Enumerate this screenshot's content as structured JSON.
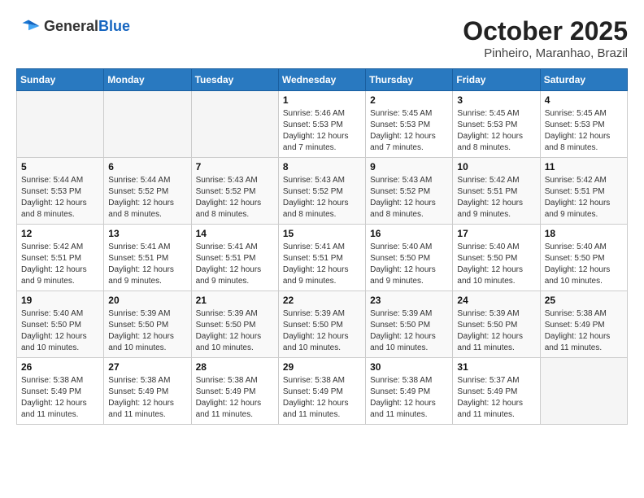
{
  "header": {
    "logo_general": "General",
    "logo_blue": "Blue",
    "month": "October 2025",
    "location": "Pinheiro, Maranhao, Brazil"
  },
  "days_of_week": [
    "Sunday",
    "Monday",
    "Tuesday",
    "Wednesday",
    "Thursday",
    "Friday",
    "Saturday"
  ],
  "weeks": [
    [
      {
        "day": "",
        "info": ""
      },
      {
        "day": "",
        "info": ""
      },
      {
        "day": "",
        "info": ""
      },
      {
        "day": "1",
        "info": "Sunrise: 5:46 AM\nSunset: 5:53 PM\nDaylight: 12 hours\nand 7 minutes."
      },
      {
        "day": "2",
        "info": "Sunrise: 5:45 AM\nSunset: 5:53 PM\nDaylight: 12 hours\nand 7 minutes."
      },
      {
        "day": "3",
        "info": "Sunrise: 5:45 AM\nSunset: 5:53 PM\nDaylight: 12 hours\nand 8 minutes."
      },
      {
        "day": "4",
        "info": "Sunrise: 5:45 AM\nSunset: 5:53 PM\nDaylight: 12 hours\nand 8 minutes."
      }
    ],
    [
      {
        "day": "5",
        "info": "Sunrise: 5:44 AM\nSunset: 5:53 PM\nDaylight: 12 hours\nand 8 minutes."
      },
      {
        "day": "6",
        "info": "Sunrise: 5:44 AM\nSunset: 5:52 PM\nDaylight: 12 hours\nand 8 minutes."
      },
      {
        "day": "7",
        "info": "Sunrise: 5:43 AM\nSunset: 5:52 PM\nDaylight: 12 hours\nand 8 minutes."
      },
      {
        "day": "8",
        "info": "Sunrise: 5:43 AM\nSunset: 5:52 PM\nDaylight: 12 hours\nand 8 minutes."
      },
      {
        "day": "9",
        "info": "Sunrise: 5:43 AM\nSunset: 5:52 PM\nDaylight: 12 hours\nand 8 minutes."
      },
      {
        "day": "10",
        "info": "Sunrise: 5:42 AM\nSunset: 5:51 PM\nDaylight: 12 hours\nand 9 minutes."
      },
      {
        "day": "11",
        "info": "Sunrise: 5:42 AM\nSunset: 5:51 PM\nDaylight: 12 hours\nand 9 minutes."
      }
    ],
    [
      {
        "day": "12",
        "info": "Sunrise: 5:42 AM\nSunset: 5:51 PM\nDaylight: 12 hours\nand 9 minutes."
      },
      {
        "day": "13",
        "info": "Sunrise: 5:41 AM\nSunset: 5:51 PM\nDaylight: 12 hours\nand 9 minutes."
      },
      {
        "day": "14",
        "info": "Sunrise: 5:41 AM\nSunset: 5:51 PM\nDaylight: 12 hours\nand 9 minutes."
      },
      {
        "day": "15",
        "info": "Sunrise: 5:41 AM\nSunset: 5:51 PM\nDaylight: 12 hours\nand 9 minutes."
      },
      {
        "day": "16",
        "info": "Sunrise: 5:40 AM\nSunset: 5:50 PM\nDaylight: 12 hours\nand 9 minutes."
      },
      {
        "day": "17",
        "info": "Sunrise: 5:40 AM\nSunset: 5:50 PM\nDaylight: 12 hours\nand 10 minutes."
      },
      {
        "day": "18",
        "info": "Sunrise: 5:40 AM\nSunset: 5:50 PM\nDaylight: 12 hours\nand 10 minutes."
      }
    ],
    [
      {
        "day": "19",
        "info": "Sunrise: 5:40 AM\nSunset: 5:50 PM\nDaylight: 12 hours\nand 10 minutes."
      },
      {
        "day": "20",
        "info": "Sunrise: 5:39 AM\nSunset: 5:50 PM\nDaylight: 12 hours\nand 10 minutes."
      },
      {
        "day": "21",
        "info": "Sunrise: 5:39 AM\nSunset: 5:50 PM\nDaylight: 12 hours\nand 10 minutes."
      },
      {
        "day": "22",
        "info": "Sunrise: 5:39 AM\nSunset: 5:50 PM\nDaylight: 12 hours\nand 10 minutes."
      },
      {
        "day": "23",
        "info": "Sunrise: 5:39 AM\nSunset: 5:50 PM\nDaylight: 12 hours\nand 10 minutes."
      },
      {
        "day": "24",
        "info": "Sunrise: 5:39 AM\nSunset: 5:50 PM\nDaylight: 12 hours\nand 11 minutes."
      },
      {
        "day": "25",
        "info": "Sunrise: 5:38 AM\nSunset: 5:49 PM\nDaylight: 12 hours\nand 11 minutes."
      }
    ],
    [
      {
        "day": "26",
        "info": "Sunrise: 5:38 AM\nSunset: 5:49 PM\nDaylight: 12 hours\nand 11 minutes."
      },
      {
        "day": "27",
        "info": "Sunrise: 5:38 AM\nSunset: 5:49 PM\nDaylight: 12 hours\nand 11 minutes."
      },
      {
        "day": "28",
        "info": "Sunrise: 5:38 AM\nSunset: 5:49 PM\nDaylight: 12 hours\nand 11 minutes."
      },
      {
        "day": "29",
        "info": "Sunrise: 5:38 AM\nSunset: 5:49 PM\nDaylight: 12 hours\nand 11 minutes."
      },
      {
        "day": "30",
        "info": "Sunrise: 5:38 AM\nSunset: 5:49 PM\nDaylight: 12 hours\nand 11 minutes."
      },
      {
        "day": "31",
        "info": "Sunrise: 5:37 AM\nSunset: 5:49 PM\nDaylight: 12 hours\nand 11 minutes."
      },
      {
        "day": "",
        "info": ""
      }
    ]
  ]
}
